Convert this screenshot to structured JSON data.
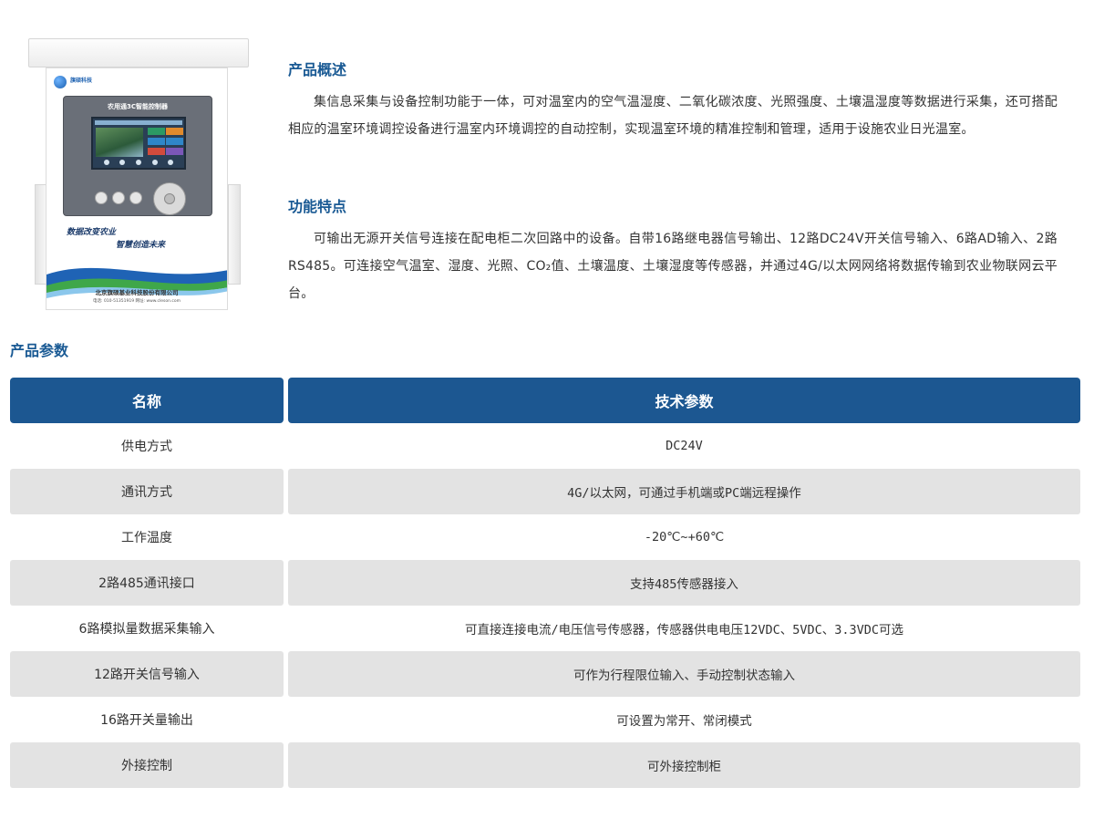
{
  "product_image": {
    "brand_name": "旗硕科技",
    "panel_title": "农用通3C智能控制器",
    "slogan_line1": "数据改变农业",
    "slogan_line2": "智慧创造未来",
    "company_name": "北京旗硕基业科技股份有限公司",
    "contact_line": "电话: 010-51351919   网址: www.cleson.com"
  },
  "overview": {
    "title": "产品概述",
    "text": "集信息采集与设备控制功能于一体，可对温室内的空气温湿度、二氧化碳浓度、光照强度、土壤温湿度等数据进行采集，还可搭配相应的温室环境调控设备进行温室内环境调控的自动控制，实现温室环境的精准控制和管理，适用于设施农业日光温室。"
  },
  "features": {
    "title": "功能特点",
    "text": "可输出无源开关信号连接在配电柜二次回路中的设备。自带16路继电器信号输出、12路DC24V开关信号输入、6路AD输入、2路RS485。可连接空气温室、湿度、光照、CO₂值、土壤温度、土壤湿度等传感器，并通过4G/以太网网络将数据传输到农业物联网云平台。"
  },
  "params": {
    "title": "产品参数",
    "headers": [
      "名称",
      "技术参数"
    ],
    "rows": [
      [
        "供电方式",
        "DC24V"
      ],
      [
        "通讯方式",
        "4G/以太网，可通过手机端或PC端远程操作"
      ],
      [
        "工作温度",
        "-20℃~+60℃"
      ],
      [
        "2路485通讯接口",
        "支持485传感器接入"
      ],
      [
        "6路模拟量数据采集输入",
        "可直接连接电流/电压信号传感器，传感器供电电压12VDC、5VDC、3.3VDC可选"
      ],
      [
        "12路开关信号输入",
        "可作为行程限位输入、手动控制状态输入"
      ],
      [
        "16路开关量输出",
        "可设置为常开、常闭模式"
      ],
      [
        "外接控制",
        "可外接控制柜"
      ]
    ]
  },
  "colors": {
    "accent_blue": "#1c5791",
    "title_blue": "#1a5a94",
    "row_shade": "#e3e3e3",
    "text": "#333333"
  }
}
